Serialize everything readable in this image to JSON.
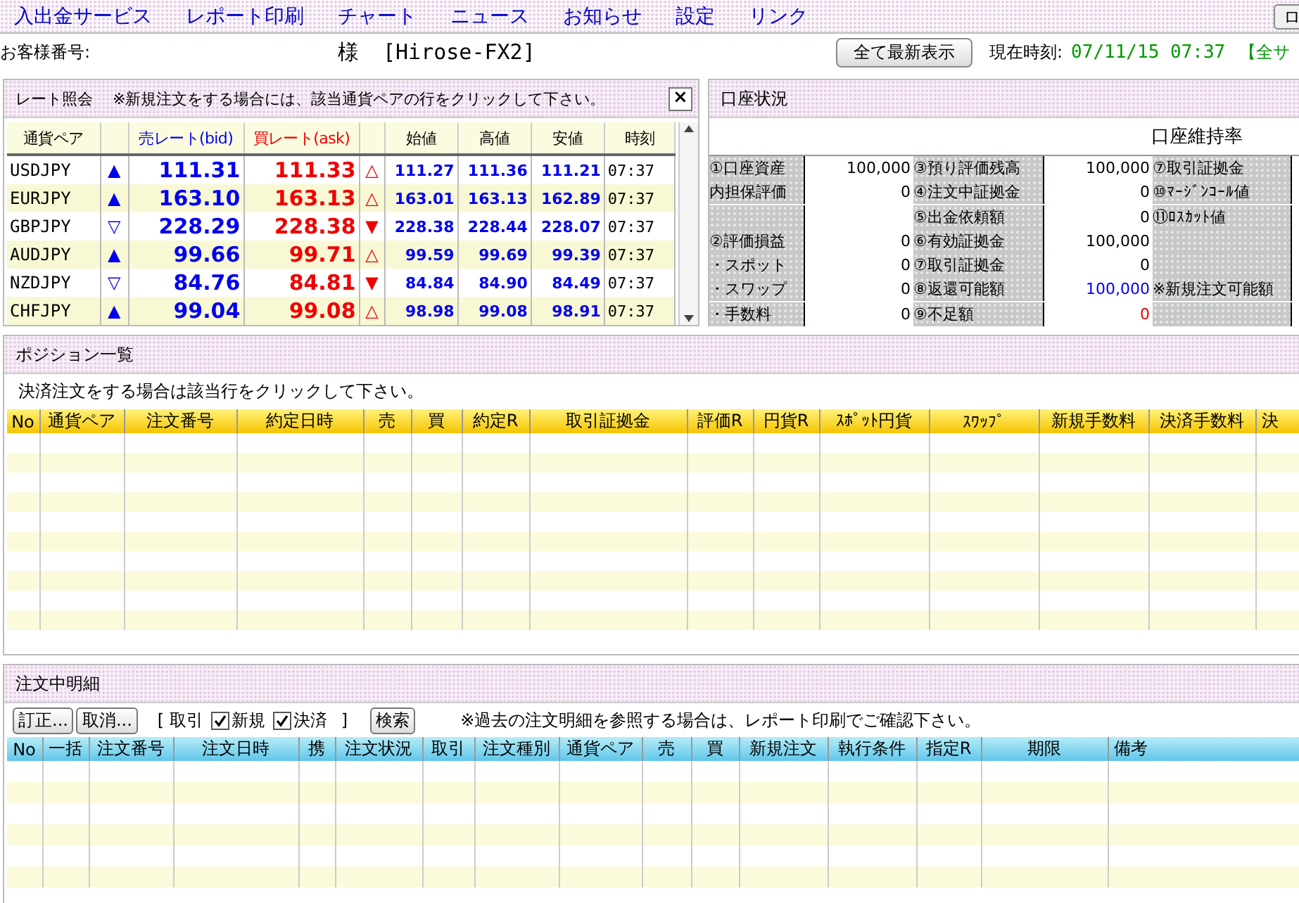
{
  "menu": {
    "items": [
      {
        "label": "入出金サービス"
      },
      {
        "label": "レポート印刷"
      },
      {
        "label": "チャート"
      },
      {
        "label": "ニュース"
      },
      {
        "label": "お知らせ"
      },
      {
        "label": "設定"
      },
      {
        "label": "リンク"
      }
    ],
    "edge_button": "ロ"
  },
  "info_bar": {
    "customer_label": "お客様番号:",
    "customer_suffix": "様",
    "account_name": "[Hirose-FX2]",
    "refresh_button": "全て最新表示",
    "time_label": "現在時刻:",
    "time_value": "07/11/15 07:37",
    "notice": "【全サ"
  },
  "rate_panel": {
    "title": "レート照会",
    "note": "※新規注文をする場合には、該当通貨ペアの行をクリックして下さい。",
    "close_button": "×",
    "columns": [
      "通貨ペア",
      "",
      "売レート(bid)",
      "買レート(ask)",
      "",
      "始値",
      "高値",
      "安値",
      "時刻"
    ],
    "rows": [
      {
        "pair": "USDJPY",
        "bid_mark": "▲",
        "bid": "111.31",
        "ask": "111.33",
        "ask_mark": "△",
        "open": "111.27",
        "high": "111.36",
        "low": "111.21",
        "time": "07:37"
      },
      {
        "pair": "EURJPY",
        "bid_mark": "▲",
        "bid": "163.10",
        "ask": "163.13",
        "ask_mark": "△",
        "open": "163.01",
        "high": "163.13",
        "low": "162.89",
        "time": "07:37"
      },
      {
        "pair": "GBPJPY",
        "bid_mark": "▽",
        "bid": "228.29",
        "ask": "228.38",
        "ask_mark": "▼",
        "open": "228.38",
        "high": "228.44",
        "low": "228.07",
        "time": "07:37"
      },
      {
        "pair": "AUDJPY",
        "bid_mark": "▲",
        "bid": "99.66",
        "ask": "99.71",
        "ask_mark": "△",
        "open": "99.59",
        "high": "99.69",
        "low": "99.39",
        "time": "07:37"
      },
      {
        "pair": "NZDJPY",
        "bid_mark": "▽",
        "bid": "84.76",
        "ask": "84.81",
        "ask_mark": "▼",
        "open": "84.84",
        "high": "84.90",
        "low": "84.49",
        "time": "07:37"
      },
      {
        "pair": "CHFJPY",
        "bid_mark": "▲",
        "bid": "99.04",
        "ask": "99.08",
        "ask_mark": "△",
        "open": "98.98",
        "high": "99.08",
        "low": "98.91",
        "time": "07:37"
      }
    ]
  },
  "account_panel": {
    "title": "口座状況",
    "ratio_label": "口座維持率",
    "rows": [
      {
        "label_a": "①口座資産",
        "value_a": "100,000",
        "label_b": "③預り評価残高",
        "value_b": "100,000",
        "highlighted": false,
        "warning": false,
        "label_c": "⑦取引証拠金"
      },
      {
        "label_a": "内担保評価",
        "value_a": "0",
        "label_b": "④注文中証拠金",
        "value_b": "0",
        "highlighted": false,
        "warning": false,
        "label_c": "⑩ﾏｰｼﾞﾝｺｰﾙ値"
      },
      {
        "label_b": "⑤出金依頼額",
        "value_b": "0",
        "highlighted": false,
        "warning": false,
        "label_c": "⑪ﾛｽｶｯﾄ値"
      },
      {
        "label_a": "②評価損益",
        "value_a": "0",
        "label_b": "⑥有効証拠金",
        "value_b": "100,000",
        "highlighted": false,
        "warning": false
      },
      {
        "label_a": "・スポット",
        "value_a": "0",
        "label_b": "⑦取引証拠金",
        "value_b": "0",
        "highlighted": false,
        "warning": false
      },
      {
        "label_a": "・スワップ",
        "value_a": "0",
        "label_b": "⑧返還可能額",
        "value_b": "100,000",
        "highlighted": true,
        "warning": false,
        "label_c": "※新規注文可能額"
      },
      {
        "label_a": "・手数料",
        "value_a": "0",
        "label_b": "⑨不足額",
        "value_b": "0",
        "highlighted": false,
        "warning": true
      }
    ]
  },
  "position_panel": {
    "title": "ポジション一覧",
    "note": "決済注文をする場合は該当行をクリックして下さい。",
    "columns": [
      "No",
      "通貨ペア",
      "注文番号",
      "約定日時",
      "売",
      "買",
      "約定R",
      "取引証拠金",
      "評価R",
      "円貨R",
      "ｽﾎﾟｯﾄ円貨",
      "ｽﾜｯﾌﾟ",
      "新規手数料",
      "決済手数料",
      "決"
    ]
  },
  "order_panel": {
    "title": "注文中明細",
    "buttons": [
      "訂正...",
      "取消..."
    ],
    "filter_open": "[ 取引",
    "checkboxes": [
      {
        "label": "新規",
        "checked": true
      },
      {
        "label": "決済",
        "checked": true
      }
    ],
    "filter_close": "]",
    "search_button": "検索",
    "note": "※過去の注文明細を参照する場合は、レポート印刷でご確認下さい。",
    "columns": [
      "No",
      "一括",
      "注文番号",
      "注文日時",
      "携",
      "注文状況",
      "取引",
      "注文種別",
      "通貨ペア",
      "売",
      "買",
      "新規注文",
      "執行条件",
      "指定R",
      "期限",
      "備考"
    ]
  }
}
